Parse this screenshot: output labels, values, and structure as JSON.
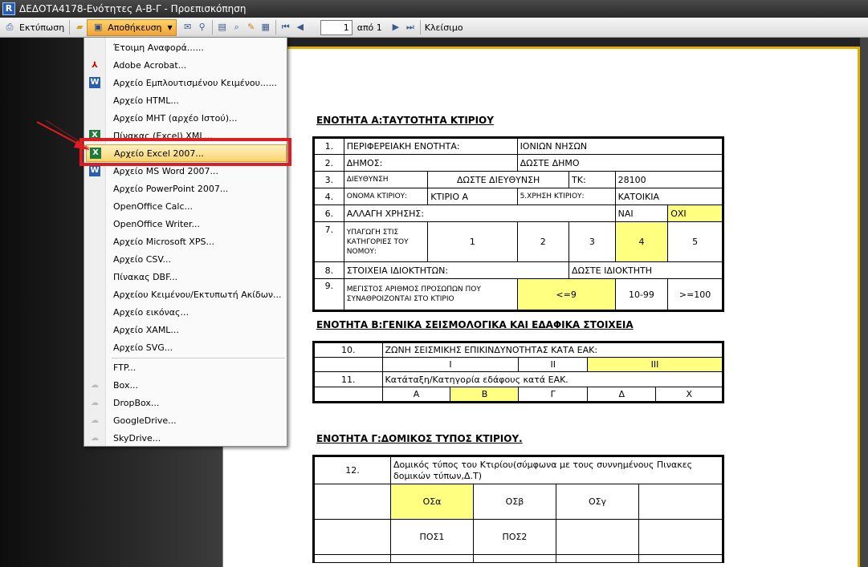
{
  "window": {
    "title": "ΔΕΔΟΤΑ4178-Ενότητες Α-Β-Γ - Προεπισκόπηση"
  },
  "toolbar": {
    "print_label": "Εκτύπωση",
    "save_label": "Αποθήκευση",
    "page_value": "1",
    "of_label": "από 1",
    "close_label": "Κλείσιμο"
  },
  "menu": {
    "items": [
      "Έτοιμη Αναφορά......",
      "Adobe Acrobat...",
      "Αρχείο Εμπλουτισμένου Κειμένου......",
      "Αρχείο HTML...",
      "Αρχείο MHT (αρχέο Ιστού)...",
      "Πίνακας (Excel) XML...",
      "Αρχείο Excel 2007...",
      "Αρχείο MS Word 2007...",
      "Αρχείο PowerPoint 2007...",
      "OpenOffice Calc...",
      "OpenOffice Writer...",
      "Αρχείο Microsoft XPS...",
      "Αρχείο CSV...",
      "Πίνακας DBF...",
      "Αρχείου Κειμένου/Εκτυπωτή Ακίδων...",
      "Αρχείο εικόνας...",
      "Αρχείο XAML...",
      "Αρχείο SVG...",
      "FTP...",
      "Box...",
      "DropBox...",
      "GoogleDrive...",
      "SkyDrive..."
    ]
  },
  "doc": {
    "secA": "ΕΝΟΤΗΤΑ Α:ΤΑΥΤΟΤΗΤΑ ΚΤΙΡΙΟΥ",
    "a1": {
      "n": "1.",
      "label": "ΠΕΡΙΦΕΡΕΙΑΚΗ ΕΝΟΤΗΤΑ:",
      "value": "ΙΟΝΙΩΝ ΝΗΣΩΝ"
    },
    "a2": {
      "n": "2.",
      "label": "ΔΗΜΟΣ:",
      "value": "ΔΩΣΤΕ ΔΗΜΟ"
    },
    "a3": {
      "n": "3.",
      "label": "ΔΙΕΥΘΥΝΣΗ",
      "value": "ΔΩΣΤΕ ΔΙΕΥΘΥΝΣΗ",
      "tk_label": "ΤΚ:",
      "tk_value": "28100"
    },
    "a4": {
      "n": "4.",
      "label": "ΟΝΟΜΑ ΚΤΙΡΙΟΥ:",
      "value": "ΚΤΙΡΙΟ Α",
      "use_label": "5.ΧΡΗΣΗ ΚΤΙΡΙΟΥ:",
      "use_value": "ΚΑΤΟΙΚΙΑ"
    },
    "a6": {
      "n": "6.",
      "label": "ΑΛΛΑΓΗ ΧΡΗΣΗΣ:",
      "yes": "ΝΑΙ",
      "no": "ΟΧΙ"
    },
    "a7": {
      "n": "7.",
      "label": "ΥΠΑΓΩΓΗ ΣΤΙΣ ΚΑΤΗΓΟΡΙΕΣ ΤΟΥ ΝΟΜΟΥ:",
      "c1": "1",
      "c2": "2",
      "c3": "3",
      "c4": "4",
      "c5": "5"
    },
    "a8": {
      "n": "8.",
      "label": "ΣΤΟΙΧΕΙΑ ΙΔΙΟΚΤΗΤΩΝ:",
      "value": "ΔΩΣΤΕ ΙΔΙΟΚΤΗΤΗ"
    },
    "a9": {
      "n": "9.",
      "label": "ΜΕΓΙΣΤΟΣ ΑΡΙΘΜΟΣ ΠΡΟΣΩΠΩΝ ΠΟΥ ΣΥΝΑΘΡΟΙΖΟΝΤΑΙ ΣΤΟ ΚΤΙΡΙΟ",
      "o1": "<=9",
      "o2": "10-99",
      "o3": ">=100"
    },
    "secB": "ΕΝΟΤΗΤΑ Β:ΓΕΝΙΚΑ ΣΕΙΣΜΟΛΟΓΙΚΑ ΚΑΙ ΕΔΑΦΙΚΑ ΣΤΟΙΧΕΙΑ",
    "b10": {
      "n": "10.",
      "label": "ΖΩΝΗ ΣΕΙΣΜΙΚΗΣ ΕΠΙΚΙΝΔΥΝΟΤΗΤΑΣ ΚΑΤΑ ΕΑΚ:",
      "z1": "Ι",
      "z2": "ΙΙ",
      "z3": "ΙΙΙ"
    },
    "b11": {
      "n": "11.",
      "label": "Κατάταξη/Κατηγορία εδάφους κατά ΕΑΚ.",
      "s1": "Α",
      "s2": "Β",
      "s3": "Γ",
      "s4": "Δ",
      "s5": "Χ"
    },
    "secC": "ΕΝΟΤΗΤΑ Γ:ΔΟΜΙΚΟΣ ΤΥΠΟΣ ΚΤΙΡΙΟΥ.",
    "c12": {
      "n": "12.",
      "label": "Δομικός τύπος του Κτιρίου(σύμφωνα με τους συννημένους Πινακες δομικών τύπων,Δ.Τ)",
      "t1": "ΟΣα",
      "t2": "ΟΣβ",
      "t3": "ΟΣγ",
      "p1": "ΠΟΣ1",
      "p2": "ΠΟΣ2"
    }
  }
}
